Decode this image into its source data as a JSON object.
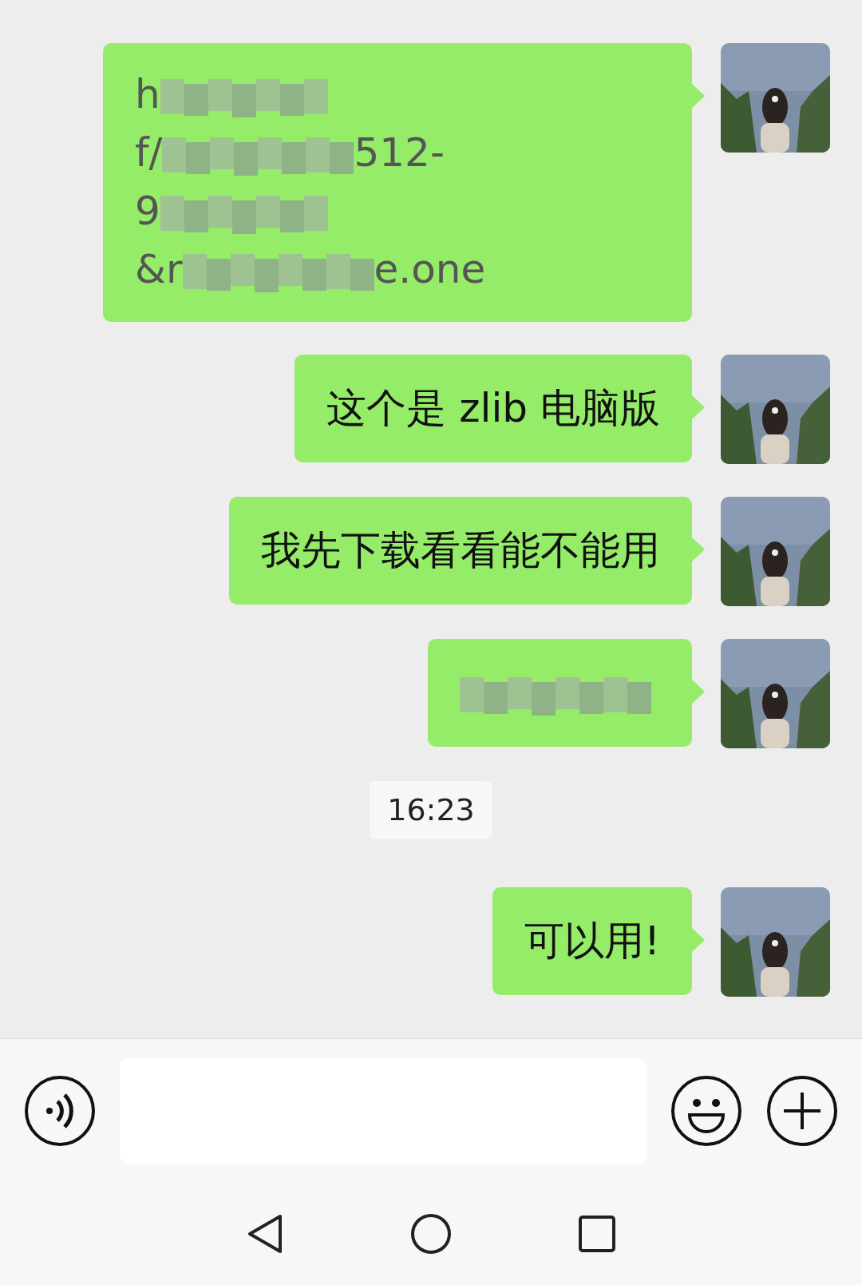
{
  "messages": [
    {
      "kind": "text-lines",
      "lines": [
        [
          {
            "kind": "text",
            "text": "h"
          },
          {
            "kind": "blur"
          }
        ],
        [
          {
            "kind": "text",
            "text": "f/"
          },
          {
            "kind": "blur"
          },
          {
            "kind": "text",
            "text": "512-"
          }
        ],
        [
          {
            "kind": "text",
            "text": "9"
          },
          {
            "kind": "blur"
          }
        ],
        [
          {
            "kind": "text",
            "text": "&r"
          },
          {
            "kind": "blur"
          },
          {
            "kind": "text",
            "text": "e.one"
          }
        ]
      ]
    },
    {
      "kind": "text",
      "text": "这个是 zlib 电脑版"
    },
    {
      "kind": "text",
      "text": "我先下载看看能不能用"
    },
    {
      "kind": "blurred"
    },
    {
      "kind": "time",
      "text": "16:23"
    },
    {
      "kind": "text",
      "text": "可以用!"
    }
  ]
}
